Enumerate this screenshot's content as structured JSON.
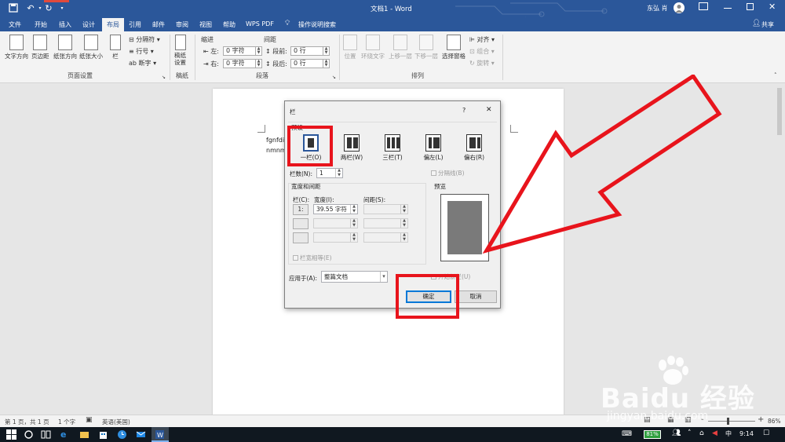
{
  "window": {
    "title": "文档1 - Word",
    "user": "东弘 肖",
    "share": "共享"
  },
  "tabs": [
    "文件",
    "开始",
    "插入",
    "设计",
    "布局",
    "引用",
    "邮件",
    "审阅",
    "视图",
    "帮助",
    "WPS PDF",
    "操作说明搜索"
  ],
  "ribbon": {
    "text_direction": "文字方向",
    "margins": "页边距",
    "orientation": "纸张方向",
    "size": "纸张大小",
    "columns": "栏",
    "breaks": "分隔符",
    "line_numbers": "行号",
    "hyphenation": "断字",
    "page_setup_group": "页面设置",
    "draft_paper": "稿纸\n设置",
    "draft_group": "稿纸",
    "indent_label": "缩进",
    "spacing_label": "间距",
    "indent_left_label": "左:",
    "indent_left_value": "0 字符",
    "indent_right_label": "右:",
    "indent_right_value": "0 字符",
    "spacing_before_label": "段前:",
    "spacing_before_value": "0 行",
    "spacing_after_label": "段后:",
    "spacing_after_value": "0 行",
    "paragraph_group": "段落",
    "position": "位置",
    "wrap_text": "环绕文字",
    "bring_forward": "上移一层",
    "send_backward": "下移一层",
    "selection_pane": "选择窗格",
    "align": "对齐",
    "group": "组合",
    "rotate": "旋转",
    "arrange_group": "排列"
  },
  "document": {
    "line1": "fgnfdig",
    "line2": "nmnmi"
  },
  "dialog": {
    "title": "栏",
    "help": "?",
    "close": "✕",
    "presets_label": "预设",
    "presets": [
      "一栏(O)",
      "两栏(W)",
      "三栏(T)",
      "偏左(L)",
      "偏右(R)"
    ],
    "num_columns_label": "栏数(N):",
    "num_columns_value": "1",
    "line_between": "分隔线(B)",
    "width_spacing_label": "宽度和间距",
    "col_header": "栏(C):",
    "width_header": "宽度(I):",
    "spacing_header": "间距(S):",
    "row1_num": "1:",
    "row1_width": "39.55 字符",
    "equal_width": "栏宽相等(E)",
    "apply_label": "应用于(A):",
    "apply_value": "整篇文档",
    "preview_label": "预览",
    "start_new_column": "开始新栏(U)",
    "ok": "确定",
    "cancel": "取消"
  },
  "status": {
    "page": "第 1 页，共 1 页",
    "words": "1 个字",
    "lang": "英语(美国)",
    "zoom": "86%",
    "minus": "-",
    "plus": "+"
  },
  "taskbar": {
    "battery": "81%",
    "time": "9:14",
    "ime": "中"
  },
  "watermark": {
    "brand": "Baidu 经验",
    "url": "jingyan.baidu.com"
  },
  "colors": {
    "word_blue": "#2b579a",
    "annotation_red": "#e8141c"
  }
}
